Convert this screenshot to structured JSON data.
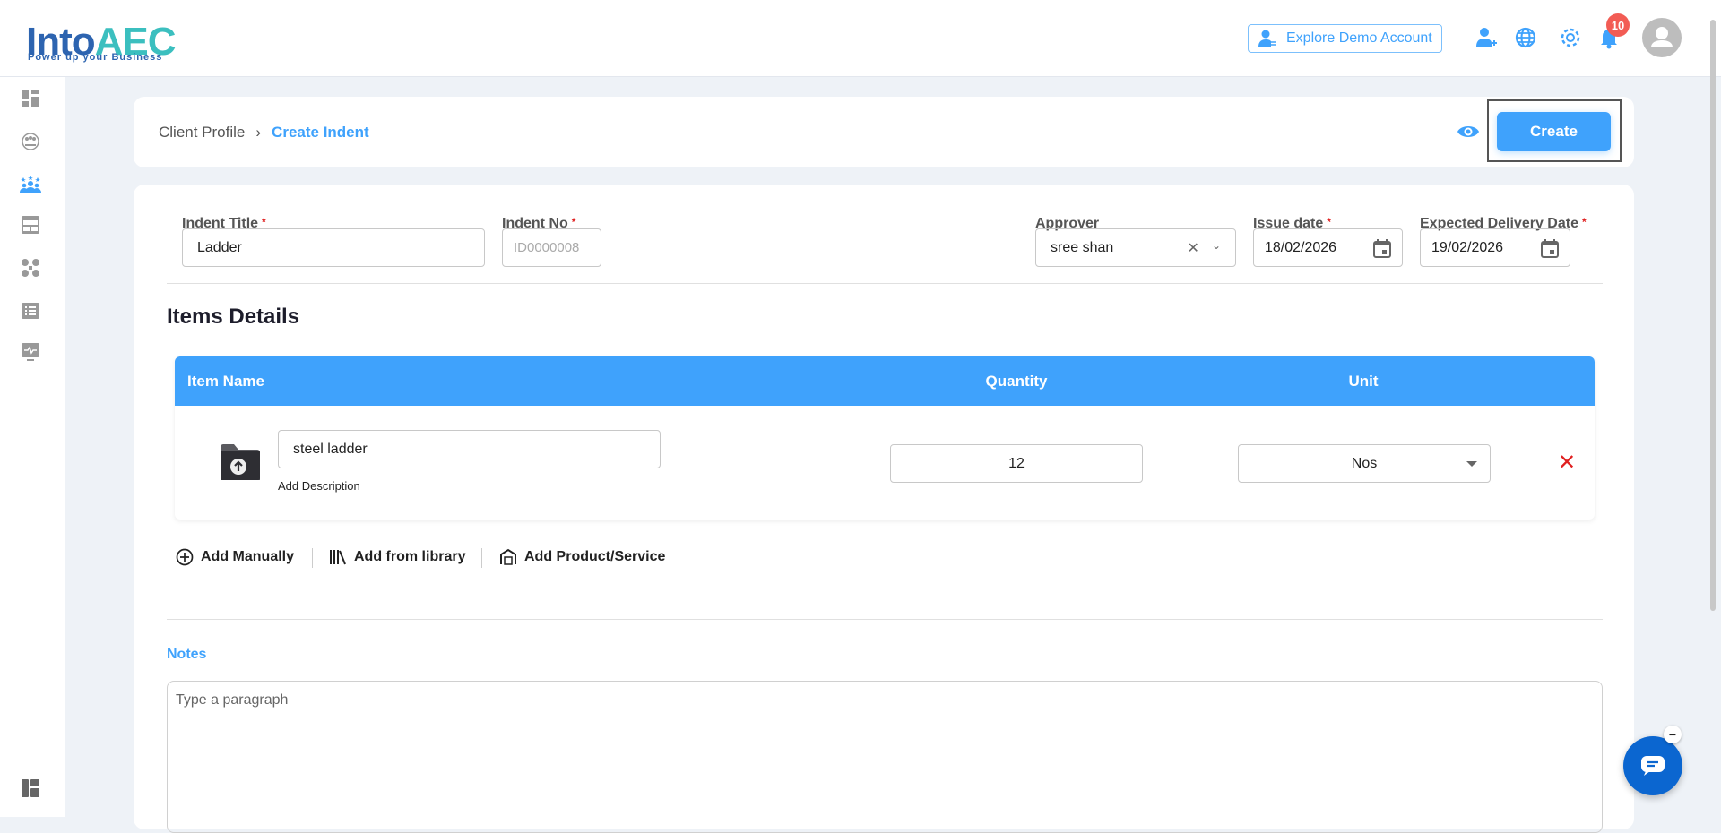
{
  "logo": {
    "name": "IntoAEC",
    "tagline": "Power up your Business"
  },
  "header": {
    "explore_demo": "Explore Demo Account",
    "notification_count": "10"
  },
  "breadcrumb": {
    "parent": "Client Profile",
    "current": "Create Indent"
  },
  "actions": {
    "create": "Create"
  },
  "form": {
    "indent_title": {
      "label": "Indent Title",
      "value": "Ladder"
    },
    "indent_no": {
      "label": "Indent No",
      "placeholder": "ID0000008"
    },
    "approver": {
      "label": "Approver",
      "value": "sree shan"
    },
    "issue_date": {
      "label": "Issue date",
      "value": "18/02/2026"
    },
    "expected_delivery": {
      "label": "Expected Delivery Date",
      "value": "19/02/2026"
    }
  },
  "items": {
    "title": "Items Details",
    "columns": [
      "Item Name",
      "Quantity",
      "Unit"
    ],
    "rows": [
      {
        "name": "steel ladder",
        "add_description": "Add Description",
        "quantity": "12",
        "unit": "Nos"
      }
    ],
    "add_manually": "Add Manually",
    "add_library": "Add from library",
    "add_product": "Add Product/Service"
  },
  "notes": {
    "label": "Notes",
    "placeholder": "Type a paragraph"
  },
  "colors": {
    "primary": "#3fa2fc",
    "dark_blue": "#2d64b0",
    "teal": "#3bbfbf",
    "danger": "#e02020"
  }
}
